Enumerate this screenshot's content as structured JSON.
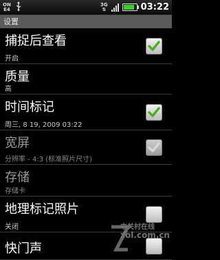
{
  "status_bar": {
    "on_label_top": "ON",
    "on_label_bottom": "E4",
    "network": "3G",
    "clock": "03:22",
    "battery_level": 0.85,
    "signal_bars": 4,
    "battery_color": "#3ecf2b"
  },
  "header": {
    "title": "设置"
  },
  "settings": [
    {
      "title": "捕捉后查看",
      "summary": "开启",
      "checkbox": true,
      "checked": true,
      "enabled": true
    },
    {
      "title": "质量",
      "summary": "高",
      "checkbox": false,
      "enabled": true
    },
    {
      "title": "时间标记",
      "summary": "周三, 8 19, 2009 03:22",
      "checkbox": true,
      "checked": true,
      "enabled": true
    },
    {
      "title": "宽屏",
      "summary": "分辨率 - 4:3 (标准照片尺寸)",
      "checkbox": true,
      "checked": true,
      "enabled": false
    },
    {
      "title": "存储",
      "summary": "存储卡",
      "checkbox": false,
      "enabled": false
    },
    {
      "title": "地理标记照片",
      "summary": "关闭",
      "checkbox": true,
      "checked": false,
      "enabled": true
    },
    {
      "title": "快门声",
      "summary": "",
      "checkbox": true,
      "checked": false,
      "enabled": true
    }
  ],
  "watermark": {
    "line1": "中关村在线",
    "line2": "zol.com.cn"
  },
  "colors": {
    "checkmark": "#4caf1e",
    "checkmark_disabled": "#d8d8d8",
    "header_bg": "#5a5a5a"
  }
}
